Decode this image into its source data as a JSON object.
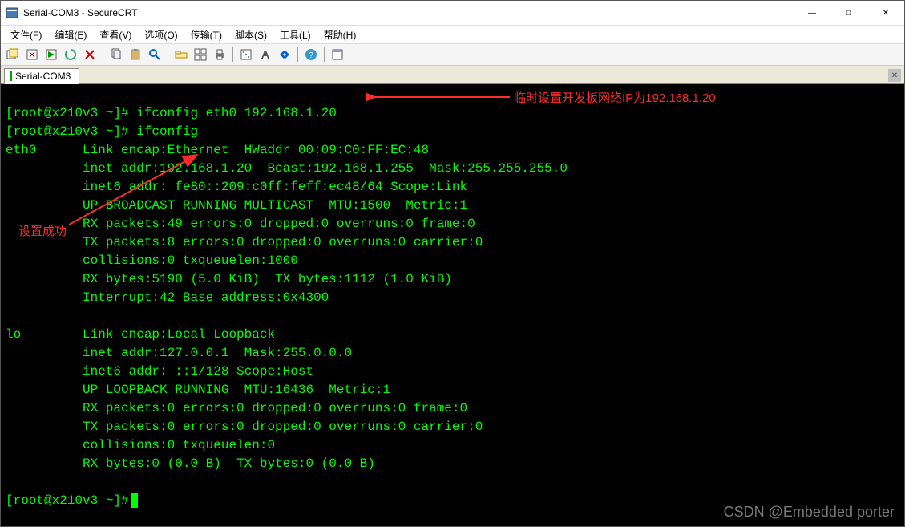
{
  "window": {
    "title": "Serial-COM3 - SecureCRT"
  },
  "menu": {
    "items": [
      "文件(F)",
      "编辑(E)",
      "查看(V)",
      "选项(O)",
      "传输(T)",
      "脚本(S)",
      "工具(L)",
      "帮助(H)"
    ]
  },
  "toolbar": {
    "icons": [
      "session-mgr-icon",
      "quick-connect-icon",
      "connect-bar-icon",
      "reconnect-icon",
      "disconnect-icon",
      "sep",
      "copy-icon",
      "paste-icon",
      "find-icon",
      "sep",
      "sftp-icon",
      "tile-icon",
      "print-icon",
      "sep",
      "options-icon",
      "keymap-icon",
      "script-icon",
      "sep",
      "help-icon",
      "sep",
      "toggle-icon"
    ]
  },
  "tab": {
    "label": "Serial-COM3"
  },
  "annotations": {
    "a1": "临时设置开发板网络IP为192.168.1.20",
    "a2": "设置成功"
  },
  "terminal": {
    "line1_prompt": "[root@x210v3 ~]#",
    "line1_cmd": " ifconfig eth0 192.168.1.20",
    "line2_prompt": "[root@x210v3 ~]#",
    "line2_cmd": " ifconfig",
    "eth0_l1": "eth0      Link encap:Ethernet  HWaddr 00:09:C0:FF:EC:48",
    "eth0_l2": "          inet addr:192.168.1.20  Bcast:192.168.1.255  Mask:255.255.255.0",
    "eth0_l3": "          inet6 addr: fe80::209:c0ff:feff:ec48/64 Scope:Link",
    "eth0_l4": "          UP BROADCAST RUNNING MULTICAST  MTU:1500  Metric:1",
    "eth0_l5": "          RX packets:49 errors:0 dropped:0 overruns:0 frame:0",
    "eth0_l6": "          TX packets:8 errors:0 dropped:0 overruns:0 carrier:0",
    "eth0_l7": "          collisions:0 txqueuelen:1000",
    "eth0_l8": "          RX bytes:5190 (5.0 KiB)  TX bytes:1112 (1.0 KiB)",
    "eth0_l9": "          Interrupt:42 Base address:0x4300",
    "blank1": "",
    "lo_l1": "lo        Link encap:Local Loopback",
    "lo_l2": "          inet addr:127.0.0.1  Mask:255.0.0.0",
    "lo_l3": "          inet6 addr: ::1/128 Scope:Host",
    "lo_l4": "          UP LOOPBACK RUNNING  MTU:16436  Metric:1",
    "lo_l5": "          RX packets:0 errors:0 dropped:0 overruns:0 frame:0",
    "lo_l6": "          TX packets:0 errors:0 dropped:0 overruns:0 carrier:0",
    "lo_l7": "          collisions:0 txqueuelen:0",
    "lo_l8": "          RX bytes:0 (0.0 B)  TX bytes:0 (0.0 B)",
    "blank2": "",
    "line3_prompt": "[root@x210v3 ~]#"
  },
  "watermark": "CSDN @Embedded porter"
}
